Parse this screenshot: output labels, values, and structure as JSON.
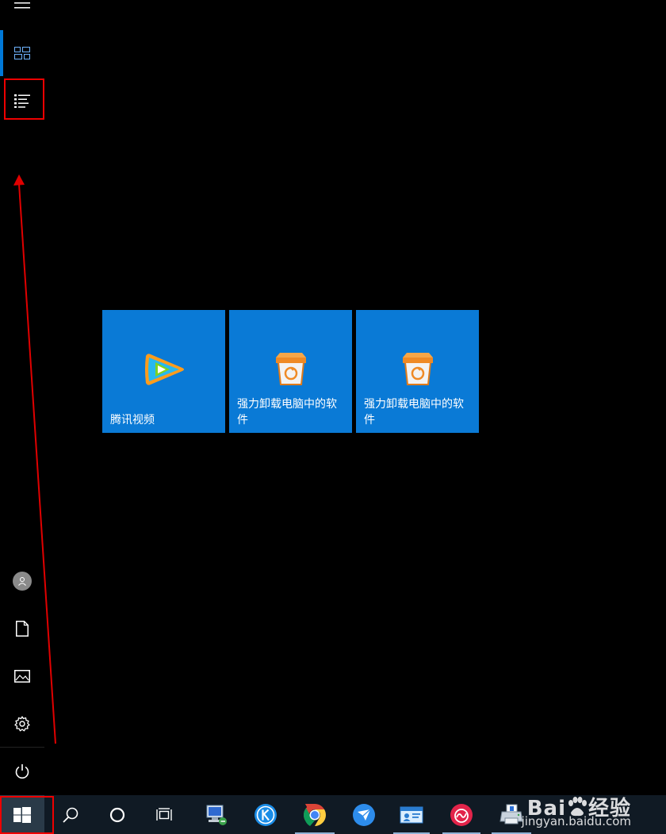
{
  "rail": {
    "items": [
      "menu",
      "tiles-view",
      "list-view",
      "user",
      "documents",
      "pictures",
      "settings",
      "power"
    ]
  },
  "tiles": [
    {
      "label": "腾讯视频",
      "icon": "tencent-video-icon"
    },
    {
      "label": "强力卸载电脑中的软件",
      "icon": "uninstall-box-icon"
    },
    {
      "label": "强力卸载电脑中的软件",
      "icon": "uninstall-box-icon"
    }
  ],
  "taskbar": {
    "items": [
      "start",
      "search",
      "cortana",
      "task-view",
      "network-computer",
      "kugou",
      "chrome",
      "feishu-bird",
      "id-card",
      "netease-music",
      "printer"
    ]
  },
  "watermark": {
    "brand": "Bai",
    "brand2": "经验",
    "url": "jingyan.baidu.com"
  },
  "colors": {
    "accent": "#0078d7",
    "tile": "#0a7ad6",
    "annotation": "#e00000"
  }
}
